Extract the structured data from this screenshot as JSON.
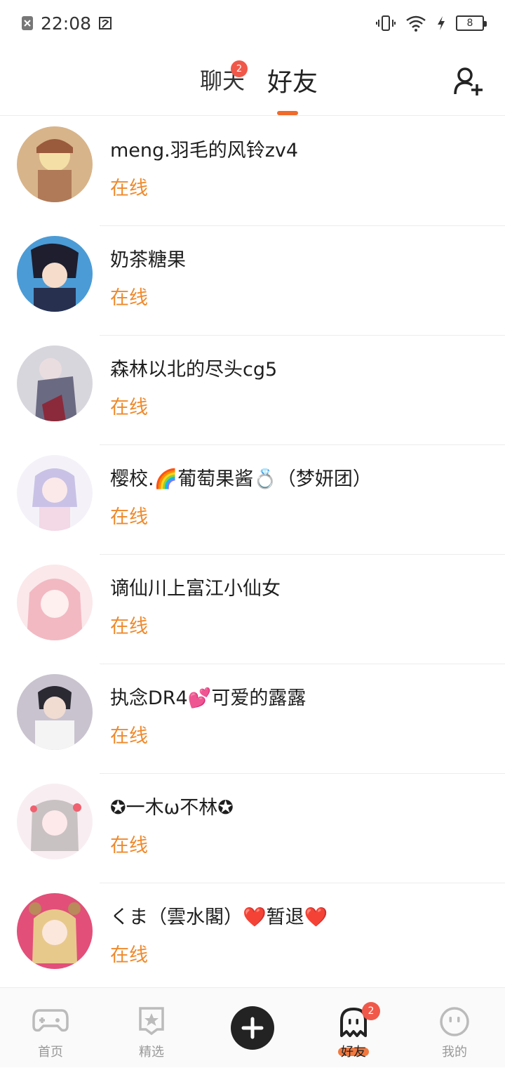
{
  "status_bar": {
    "time": "22:08",
    "battery": "8"
  },
  "header": {
    "tabs": [
      {
        "label": "聊天",
        "badge": "2"
      },
      {
        "label": "好友"
      }
    ],
    "accent": "#f06a2a"
  },
  "friends": [
    {
      "name": "meng.羽毛的风铃zv4",
      "status": "在线",
      "avatar_color": "#d8b48a"
    },
    {
      "name": "奶茶糖果",
      "status": "在线",
      "avatar_color": "#3a4a7a"
    },
    {
      "name": "森林以北的尽头cg5",
      "status": "在线",
      "avatar_color": "#a7a3b3"
    },
    {
      "name": "樱校.🌈葡萄果酱💍（梦妍团）",
      "status": "在线",
      "avatar_color": "#c9c2e6"
    },
    {
      "name": "谪仙川上富江小仙女",
      "status": "在线",
      "avatar_color": "#f2b9c2"
    },
    {
      "name": "执念DR4💕可爱的露露",
      "status": "在线",
      "avatar_color": "#5c5968"
    },
    {
      "name": "✪一木ω不林✪",
      "status": "在线",
      "avatar_color": "#f2c9d3"
    },
    {
      "name": "くま（雲水閣）❤️暂退❤️",
      "status": "在线",
      "avatar_color": "#e24f79"
    }
  ],
  "bottom_nav": [
    {
      "label": "首页",
      "icon": "gamepad-icon"
    },
    {
      "label": "精选",
      "icon": "star-icon"
    },
    {
      "label": "",
      "icon": "plus-icon"
    },
    {
      "label": "好友",
      "icon": "ghost-icon",
      "badge": "2"
    },
    {
      "label": "我的",
      "icon": "face-icon"
    }
  ]
}
